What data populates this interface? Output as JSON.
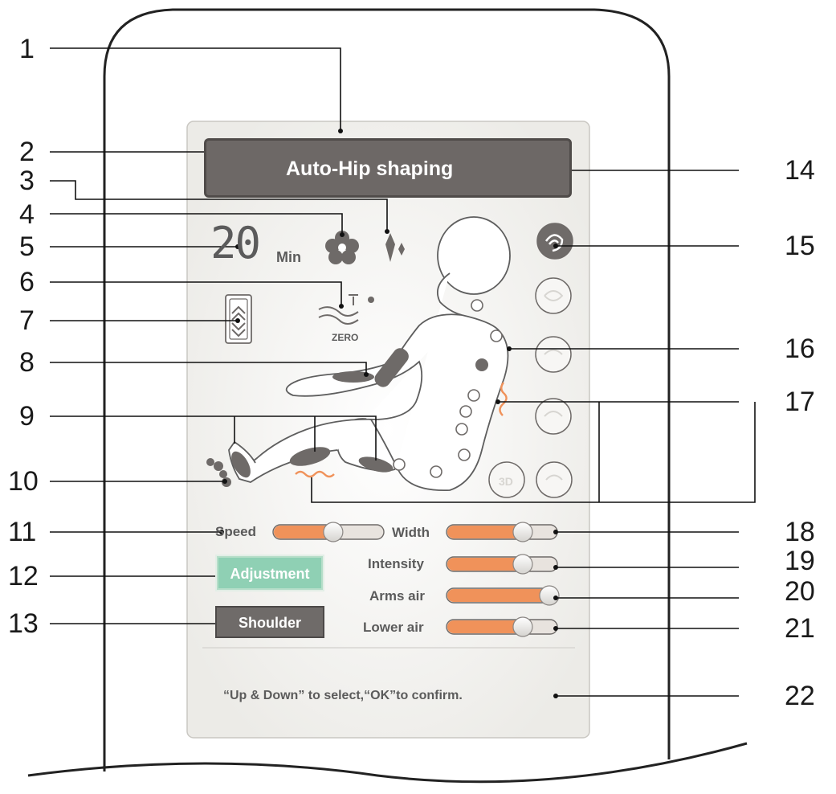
{
  "display": {
    "mode_title": "Auto-Hip shaping",
    "timer_value": "20",
    "timer_unit": "Min",
    "zero_label": "ZERO",
    "hint": "“Up &  Down” to select,“OK”to confirm."
  },
  "sliders": [
    {
      "label": "Speed",
      "level": 0.55
    },
    {
      "label": "Width",
      "level": 0.72
    },
    {
      "label": "Intensity",
      "level": 0.72
    },
    {
      "label": "Arms air",
      "level": 1.0
    },
    {
      "label": "Lower air",
      "level": 0.72
    }
  ],
  "buttons": {
    "adjustment": "Adjustment",
    "shoulder": "Shoulder"
  },
  "callouts": [
    "1",
    "2",
    "3",
    "4",
    "5",
    "6",
    "7",
    "8",
    "9",
    "10",
    "11",
    "12",
    "13",
    "14",
    "15",
    "16",
    "17",
    "18",
    "19",
    "20",
    "21",
    "22"
  ],
  "icons": {
    "bluetooth": "bluetooth-icon",
    "fan": "fan-icon",
    "sparkle": "sparkle-icon",
    "zero_gravity": "zero-gravity-icon",
    "back_adjust": "back-adjust-icon",
    "foot_roller": "foot-roller-icon",
    "massage_modes": "massage-mode-icon"
  },
  "colors": {
    "panel_bg": "#f2f1ee",
    "title_bar": "#6d6866",
    "slider_fill": "#f0925a",
    "adjustment_button": "#8fd0b4",
    "shoulder_button": "#6f6b69",
    "heat_wave": "#f0925a"
  }
}
